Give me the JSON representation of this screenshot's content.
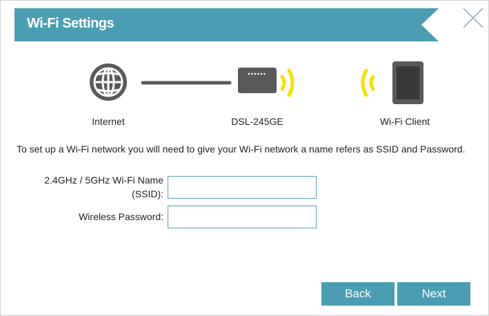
{
  "header": {
    "title": "Wi-Fi Settings"
  },
  "diagram": {
    "internet_label": "Internet",
    "router_label": "DSL-245GE",
    "client_label": "Wi-Fi Client"
  },
  "description": "To set up a Wi-Fi network you will need to give your Wi-Fi network a name refers as SSID and Password.",
  "form": {
    "ssid_label_line1": "2.4GHz / 5GHz Wi-Fi Name",
    "ssid_label_line2": "(SSID):",
    "ssid_value": "",
    "password_label": "Wireless Password:",
    "password_value": ""
  },
  "buttons": {
    "back": "Back",
    "next": "Next"
  },
  "colors": {
    "accent": "#4a9db3",
    "wifi_wave": "#f5e000",
    "device": "#5a5a5a"
  },
  "icons": [
    "close-icon",
    "globe-icon",
    "router-icon",
    "wifi-wave-icon",
    "tablet-icon"
  ]
}
